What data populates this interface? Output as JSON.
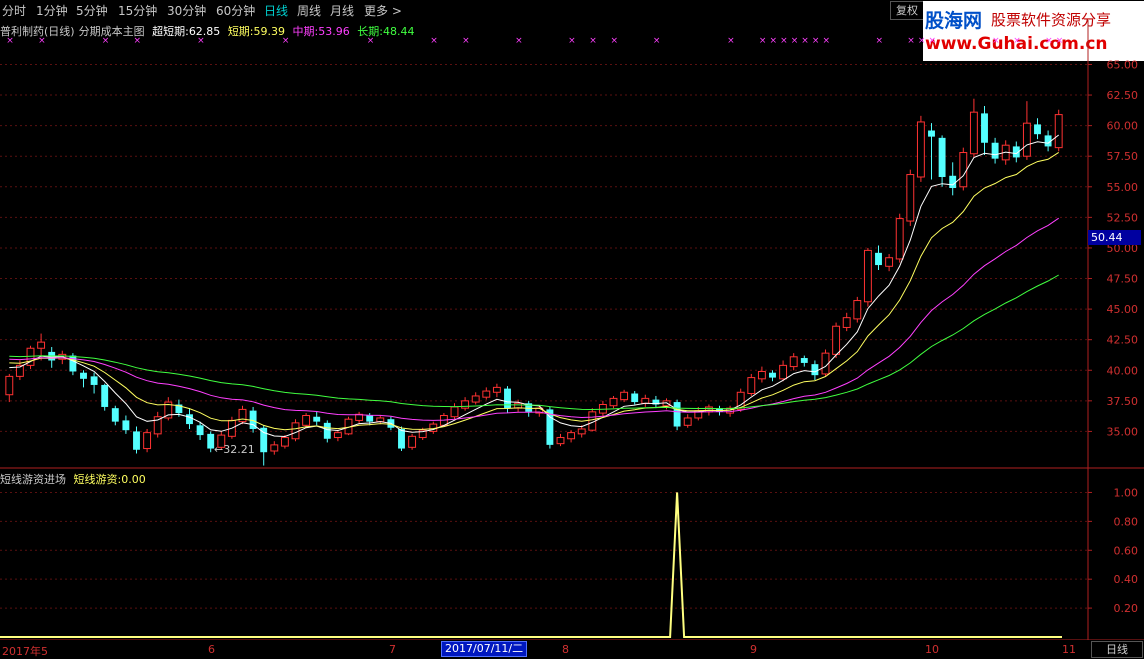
{
  "toolbar": {
    "tabs": [
      "分时",
      "1分钟",
      "5分钟",
      "15分钟",
      "30分钟",
      "60分钟",
      "日线",
      "周线",
      "月线",
      "更多 >"
    ],
    "active_tab": "日线",
    "restore_label": "复权"
  },
  "logo": {
    "line1": "股海网",
    "line2": "股票软件资源分享",
    "line3": "www.Guhai.com.cn"
  },
  "main_indicator": {
    "stock": "普利制药(日线)",
    "indicator": "分期成本主图",
    "items": [
      {
        "label": "超短期:",
        "value": "62.85",
        "color": "#ffffff"
      },
      {
        "label": "短期:",
        "value": "59.39",
        "color": "#ffff60"
      },
      {
        "label": "中期:",
        "value": "53.96",
        "color": "#ff40ff"
      },
      {
        "label": "长期:",
        "value": "48.44",
        "color": "#40ff40"
      }
    ]
  },
  "sub_indicator": {
    "name": "短线游资进场",
    "label": "短线游资:",
    "value": "0.00"
  },
  "price_axis": {
    "ticks": [
      "65.00",
      "62.50",
      "60.00",
      "57.50",
      "55.00",
      "52.50",
      "50.00",
      "47.50",
      "45.00",
      "42.50",
      "40.00",
      "37.50",
      "35.00"
    ],
    "current": "50.44"
  },
  "sub_axis": {
    "ticks": [
      "1.00",
      "0.80",
      "0.60",
      "0.40",
      "0.20"
    ]
  },
  "low_marker": "←32.21",
  "x_axis": {
    "labels": [
      "2017年5",
      "6",
      "7",
      "8",
      "9",
      "10",
      "11"
    ],
    "cursor_date": "2017/07/11/二"
  },
  "period_label": "日线",
  "chart_data": {
    "type": "candlestick",
    "ylim": [
      32.5,
      67
    ],
    "sub_ylim": [
      0,
      1.1
    ],
    "x_count": 100,
    "candles": [
      [
        38.0,
        39.5,
        37.4,
        39.7
      ],
      [
        39.5,
        40.4,
        39.2,
        40.8
      ],
      [
        40.4,
        41.8,
        40.1,
        42.0
      ],
      [
        41.8,
        42.3,
        40.8,
        43.0
      ],
      [
        41.5,
        40.8,
        40.2,
        41.9
      ],
      [
        40.9,
        41.3,
        40.5,
        41.6
      ],
      [
        41.2,
        39.9,
        39.6,
        41.4
      ],
      [
        39.8,
        39.3,
        38.6,
        40.0
      ],
      [
        39.5,
        38.8,
        38.1,
        39.8
      ],
      [
        38.8,
        37.0,
        36.7,
        38.9
      ],
      [
        36.9,
        35.8,
        35.5,
        37.1
      ],
      [
        35.9,
        35.1,
        34.8,
        36.3
      ],
      [
        35.0,
        33.5,
        33.2,
        35.4
      ],
      [
        33.6,
        34.9,
        33.3,
        35.2
      ],
      [
        34.8,
        36.2,
        34.5,
        36.6
      ],
      [
        36.1,
        37.4,
        35.9,
        37.8
      ],
      [
        37.2,
        36.5,
        36.2,
        37.6
      ],
      [
        36.4,
        35.6,
        35.2,
        36.9
      ],
      [
        35.5,
        34.7,
        34.3,
        35.8
      ],
      [
        34.8,
        33.6,
        33.3,
        35.0
      ],
      [
        33.7,
        34.7,
        33.5,
        35.0
      ],
      [
        34.6,
        35.9,
        34.4,
        36.2
      ],
      [
        35.8,
        36.8,
        35.6,
        37.1
      ],
      [
        36.7,
        35.2,
        34.9,
        37.0
      ],
      [
        35.3,
        33.3,
        32.21,
        35.5
      ],
      [
        33.4,
        33.9,
        33.1,
        34.2
      ],
      [
        33.8,
        34.5,
        33.6,
        34.7
      ],
      [
        34.4,
        35.7,
        34.2,
        36.0
      ],
      [
        35.5,
        36.3,
        35.3,
        36.5
      ],
      [
        36.2,
        35.8,
        35.5,
        36.6
      ],
      [
        35.7,
        34.4,
        34.1,
        35.9
      ],
      [
        34.5,
        34.9,
        34.2,
        35.1
      ],
      [
        34.8,
        36.0,
        34.7,
        36.2
      ],
      [
        35.9,
        36.4,
        35.7,
        36.6
      ],
      [
        36.3,
        35.8,
        35.5,
        36.5
      ],
      [
        35.8,
        36.1,
        35.6,
        36.3
      ],
      [
        36.0,
        35.3,
        35.1,
        36.2
      ],
      [
        35.2,
        33.6,
        33.4,
        35.4
      ],
      [
        33.7,
        34.6,
        33.5,
        34.8
      ],
      [
        34.5,
        35.1,
        34.3,
        35.3
      ],
      [
        35.0,
        35.6,
        34.8,
        35.8
      ],
      [
        35.5,
        36.3,
        35.4,
        36.5
      ],
      [
        36.2,
        37.0,
        36.0,
        37.3
      ],
      [
        36.9,
        37.5,
        36.7,
        37.8
      ],
      [
        37.4,
        37.9,
        37.2,
        38.2
      ],
      [
        37.8,
        38.3,
        37.6,
        38.6
      ],
      [
        38.2,
        38.6,
        37.8,
        38.9
      ],
      [
        38.5,
        36.9,
        36.5,
        38.7
      ],
      [
        36.9,
        37.3,
        36.6,
        37.6
      ],
      [
        37.3,
        36.6,
        36.2,
        37.5
      ],
      [
        36.5,
        36.9,
        36.2,
        37.1
      ],
      [
        36.8,
        33.9,
        33.6,
        37.0
      ],
      [
        34.0,
        34.5,
        33.8,
        34.8
      ],
      [
        34.4,
        34.9,
        34.1,
        35.1
      ],
      [
        34.8,
        35.2,
        34.5,
        35.5
      ],
      [
        35.1,
        36.6,
        35.0,
        36.9
      ],
      [
        36.5,
        37.2,
        36.2,
        37.5
      ],
      [
        37.1,
        37.7,
        36.9,
        37.9
      ],
      [
        37.6,
        38.2,
        37.4,
        38.4
      ],
      [
        38.1,
        37.4,
        37.2,
        38.3
      ],
      [
        37.3,
        37.7,
        37.0,
        38.0
      ],
      [
        37.6,
        37.2,
        36.9,
        37.9
      ],
      [
        37.1,
        37.5,
        36.8,
        37.7
      ],
      [
        37.4,
        35.4,
        35.1,
        37.6
      ],
      [
        35.5,
        36.1,
        35.3,
        36.4
      ],
      [
        36.1,
        36.7,
        35.9,
        37.0
      ],
      [
        36.6,
        37.0,
        36.3,
        37.2
      ],
      [
        36.9,
        36.6,
        36.3,
        37.1
      ],
      [
        36.5,
        36.9,
        36.2,
        37.1
      ],
      [
        36.8,
        38.2,
        36.6,
        38.5
      ],
      [
        38.1,
        39.4,
        37.9,
        39.7
      ],
      [
        39.3,
        39.9,
        39.0,
        40.3
      ],
      [
        39.8,
        39.4,
        39.1,
        40.0
      ],
      [
        39.3,
        40.4,
        39.1,
        40.8
      ],
      [
        40.3,
        41.1,
        40.0,
        41.4
      ],
      [
        41.0,
        40.6,
        40.3,
        41.2
      ],
      [
        40.5,
        39.6,
        39.2,
        40.8
      ],
      [
        39.7,
        41.4,
        39.5,
        41.7
      ],
      [
        41.3,
        43.6,
        41.0,
        43.9
      ],
      [
        43.5,
        44.3,
        43.2,
        44.7
      ],
      [
        44.2,
        45.7,
        43.9,
        46.0
      ],
      [
        45.6,
        49.8,
        45.2,
        50.0
      ],
      [
        49.6,
        48.6,
        48.2,
        50.2
      ],
      [
        48.5,
        49.2,
        48.1,
        49.5
      ],
      [
        49.1,
        52.4,
        48.8,
        52.8
      ],
      [
        52.2,
        56.0,
        51.8,
        56.4
      ],
      [
        55.8,
        60.3,
        55.4,
        60.8
      ],
      [
        59.6,
        59.1,
        55.6,
        60.2
      ],
      [
        59.0,
        55.8,
        55.0,
        59.2
      ],
      [
        55.9,
        54.9,
        54.3,
        57.0
      ],
      [
        55.0,
        57.8,
        54.7,
        58.2
      ],
      [
        57.7,
        61.1,
        57.4,
        62.2
      ],
      [
        61.0,
        58.6,
        57.6,
        61.6
      ],
      [
        58.6,
        57.3,
        56.9,
        59.0
      ],
      [
        57.2,
        58.4,
        56.8,
        58.8
      ],
      [
        58.3,
        57.4,
        57.0,
        58.7
      ],
      [
        57.5,
        60.2,
        57.2,
        62.0
      ],
      [
        60.1,
        59.3,
        58.9,
        60.6
      ],
      [
        59.2,
        58.3,
        57.9,
        59.6
      ],
      [
        58.2,
        60.9,
        57.9,
        61.3
      ]
    ],
    "signal_index": 63,
    "signal_value": 1.0
  }
}
